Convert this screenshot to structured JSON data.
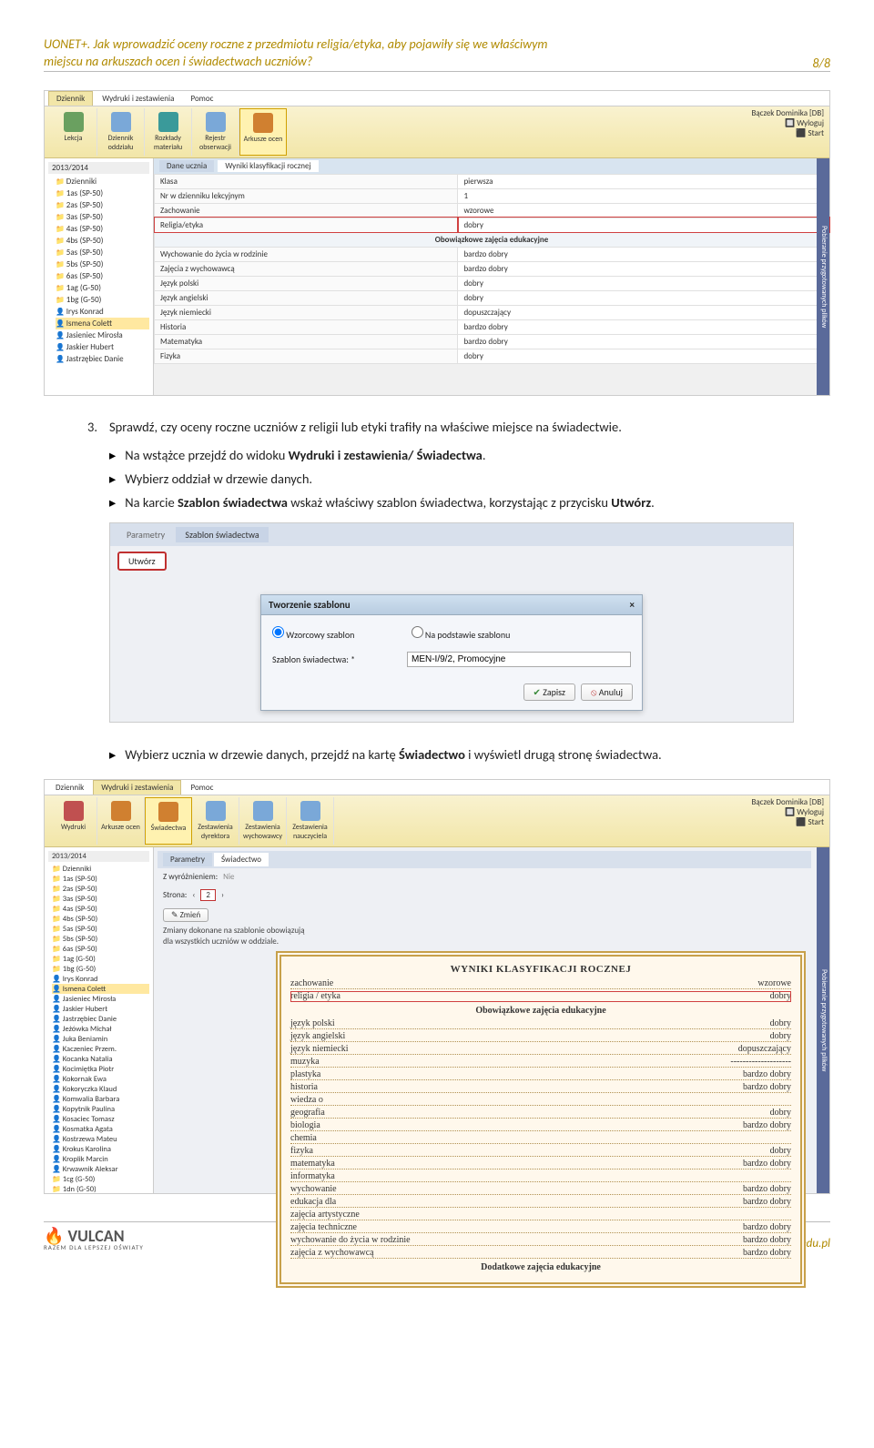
{
  "header": {
    "title_l1": "UONET+. Jak wprowadzić oceny roczne z przedmiotu religia/etyka, aby pojawiły się we właściwym",
    "title_l2": "miejscu na arkuszach ocen i świadectwach uczniów?",
    "page": "8/8"
  },
  "screenshot1": {
    "ribbon_left_tabs": [
      "Dziennik",
      "Wydruki i zestawienia",
      "Pomoc"
    ],
    "ribbon_user": "Bączek Dominika [DB]",
    "ribbon_logout": "Wyloguj",
    "ribbon_start": "Start",
    "toolbar": {
      "lekcja": "Lekcja",
      "dziennik": "Dziennik oddziału",
      "rozkl": "Rozkłady materiału",
      "rejestr": "Rejestr obserwacji",
      "arkusze": "Arkusze ocen"
    },
    "year": "2013/2014",
    "root": "Dzienniki",
    "classes": [
      "1as (SP-50)",
      "2as (SP-50)",
      "3as (SP-50)",
      "4as (SP-50)",
      "4bs (SP-50)",
      "5as (SP-50)",
      "5bs (SP-50)",
      "6as (SP-50)",
      "1ag (G-50)",
      "1bg (G-50)"
    ],
    "persons": [
      "Irys Konrad",
      "Ismena Colett",
      "Jasieniec Mirosła",
      "Jaskier Hubert",
      "Jastrzębiec Danie"
    ],
    "selected_person": "Ismena Colett",
    "subtabs": {
      "a": "Dane ucznia",
      "b": "Wyniki klasyfikacji rocznej"
    },
    "rows": {
      "klasa_l": "Klasa",
      "klasa_v": "pierwsza",
      "nr_l": "Nr w dzienniku lekcyjnym",
      "nr_v": "1",
      "zach_l": "Zachowanie",
      "zach_v": "wzorowe",
      "rel_l": "Religia/etyka",
      "rel_v": "dobry",
      "section": "Obowiązkowe zajęcia edukacyjne",
      "wych_l": "Wychowanie do życia w rodzinie",
      "wych_v": "bardzo dobry",
      "zaj_l": "Zajęcia z wychowawcą",
      "zaj_v": "bardzo dobry",
      "jp_l": "Język polski",
      "jp_v": "dobry",
      "ja_l": "Język angielski",
      "ja_v": "dobry",
      "jn_l": "Język niemiecki",
      "jn_v": "dopuszczający",
      "hi_l": "Historia",
      "hi_v": "bardzo dobry",
      "ma_l": "Matematyka",
      "ma_v": "bardzo dobry",
      "fi_l": "Fizyka",
      "fi_v": "dobry"
    },
    "side_r": "Pobieranie przygotowanych plików"
  },
  "text": {
    "step3_n": "3.",
    "step3": "Sprawdź, czy oceny roczne uczniów z religii lub etyki trafiły na właściwe miejsce na świadectwie.",
    "b1_pre": "Na wstążce przejdź do widoku ",
    "b1_b": "Wydruki i zestawienia/ Świadectwa",
    "b1_post": ".",
    "b2": "Wybierz oddział w drzewie danych.",
    "b3_pre": "Na karcie ",
    "b3_b1": "Szablon świadectwa",
    "b3_mid": " wskaż właściwy szablon świadectwa, korzystając z przycisku ",
    "b3_b2": "Utwórz",
    "b3_post": ".",
    "b4_pre": "Wybierz ucznia w drzewie danych, przejdź na kartę ",
    "b4_b": "Świadectwo",
    "b4_post": " i wyświetl drugą stronę świadectwa."
  },
  "screenshot2": {
    "tabs": {
      "a": "Parametry",
      "b": "Szablon świadectwa"
    },
    "utworz": "Utwórz",
    "dialog_title": "Tworzenie szablonu",
    "close": "×",
    "radio1": "Wzorcowy szablon",
    "radio2": "Na podstawie szablonu",
    "form_label": "Szablon świadectwa: *",
    "form_value": "MEN-I/9/2, Promocyjne",
    "save": "Zapisz",
    "cancel": "Anuluj"
  },
  "screenshot3": {
    "ribbon_left_tabs": [
      "Dziennik",
      "Wydruki i zestawienia",
      "Pomoc"
    ],
    "ribbon_user": "Bączek Dominika [DB]",
    "ribbon_logout": "Wyloguj",
    "ribbon_start": "Start",
    "toolbar": {
      "wydruki": "Wydruki",
      "arkusze": "Arkusze ocen",
      "swiad": "Świadectwa",
      "zdyr": "Zestawienia dyrektora",
      "zwych": "Zestawienia wychowawcy",
      "znau": "Zestawienia nauczyciela"
    },
    "year": "2013/2014",
    "root": "Dzienniki",
    "classes": [
      "1as (SP-50)",
      "2as (SP-50)",
      "3as (SP-50)",
      "4as (SP-50)",
      "4bs (SP-50)",
      "5as (SP-50)",
      "5bs (SP-50)",
      "6as (SP-50)",
      "1ag (G-50)",
      "1bg (G-50)"
    ],
    "persons": [
      "Irys Konrad",
      "Ismena Colett",
      "Jasieniec Mirosła",
      "Jaskier Hubert",
      "Jastrzębiec Danie",
      "Jeżówka Michał",
      "Juka Beniamin",
      "Kaczeniec Przem.",
      "Kocanka Natalia",
      "Kocimiętka Piotr",
      "Kokornak Ewa",
      "Kokoryczka Klaud",
      "Komwalia Barbara",
      "Kopytnik Paulina",
      "Kosaciec Tomasz",
      "Kosmatka Agata",
      "Kostrzewa Mateu",
      "Krokus Karolina",
      "Kroplik Marcin",
      "Krwawnik Aleksar"
    ],
    "more": [
      "1cg (G-50)",
      "1dn (G-50)"
    ],
    "selected_person": "Ismena Colett",
    "tabs": {
      "a": "Parametry",
      "b": "Świadectwo"
    },
    "wyroz_l": "Z wyróżnieniem:",
    "wyroz_v": "Nie",
    "strona_l": "Strona:",
    "strona_v": "2",
    "zmien": "Zmień",
    "note": "Zmiany dokonane na szablonie obowiązują dla wszystkich uczniów w oddziale.",
    "cert": {
      "title": "WYNIKI KLASYFIKACJI ROCZNEJ",
      "zach_l": "zachowanie",
      "zach_v": "wzorowe",
      "rel_l": "religia / etyka",
      "rel_v": "dobry",
      "sec1": "Obowiązkowe zajęcia edukacyjne",
      "rows": [
        {
          "l": "język polski",
          "v": "dobry"
        },
        {
          "l": "język angielski",
          "v": "dobry"
        },
        {
          "l": "język niemiecki",
          "v": "dopuszczający"
        },
        {
          "l": "muzyka",
          "v": "--------------------"
        },
        {
          "l": "plastyka",
          "v": "bardzo dobry"
        },
        {
          "l": "historia",
          "v": "bardzo dobry"
        },
        {
          "l": "wiedza o",
          "v": ""
        },
        {
          "l": "geografia",
          "v": "dobry"
        },
        {
          "l": "biologia",
          "v": "bardzo dobry"
        },
        {
          "l": "chemia",
          "v": ""
        },
        {
          "l": "fizyka",
          "v": "dobry"
        },
        {
          "l": "matematyka",
          "v": "bardzo dobry"
        },
        {
          "l": "informatyka",
          "v": ""
        },
        {
          "l": "wychowanie",
          "v": "bardzo dobry"
        },
        {
          "l": "edukacja dla",
          "v": "bardzo dobry"
        },
        {
          "l": "zajęcia artystyczne",
          "v": ""
        },
        {
          "l": "zajęcia techniczne",
          "v": "bardzo dobry"
        },
        {
          "l": "wychowanie do życia w rodzinie",
          "v": "bardzo dobry"
        },
        {
          "l": "zajęcia z wychowawcą",
          "v": "bardzo dobry"
        }
      ],
      "sec2": "Dodatkowe zajęcia edukacyjne"
    },
    "side_r": "Pobieranie przygotowanych plików"
  },
  "footer": {
    "logo": "VULCAN",
    "logo_sub": "RAZEM DLA LEPSZEJ OŚWIATY",
    "url": "www.vulcan.edu.pl"
  }
}
